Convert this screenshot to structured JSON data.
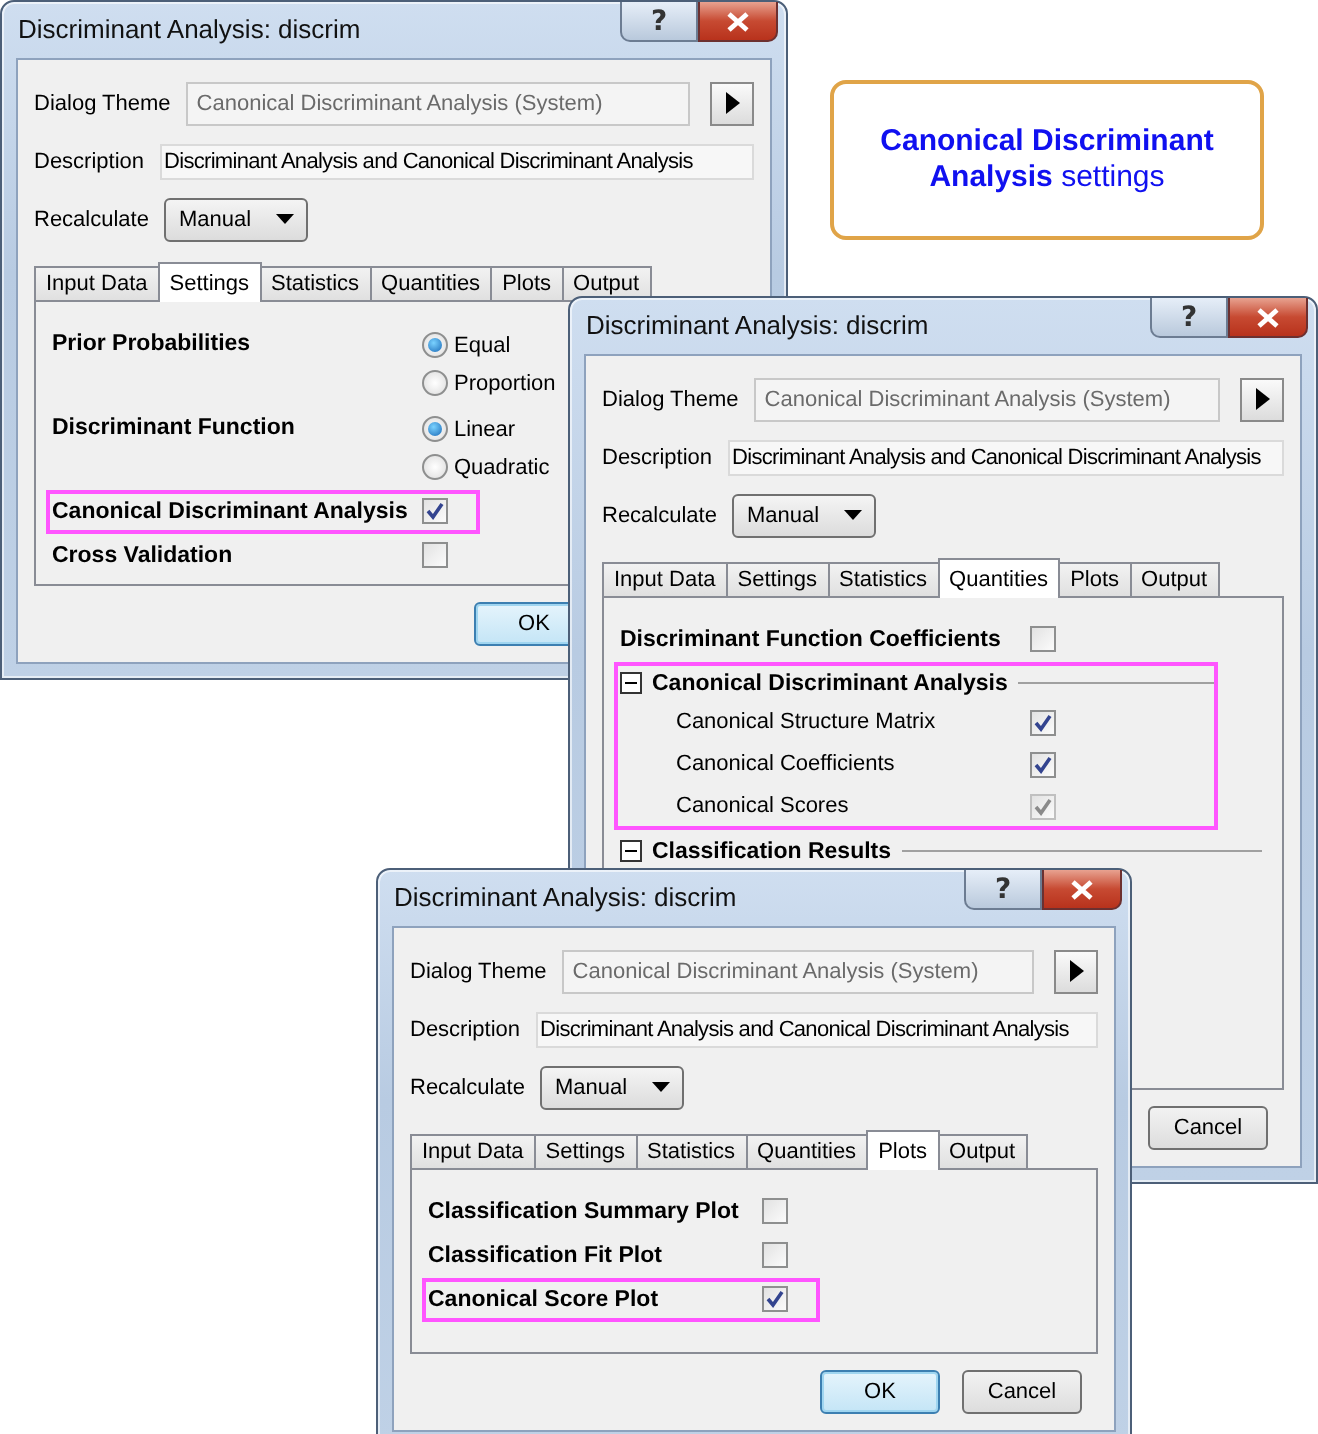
{
  "callout": {
    "text": "**Canonical Discriminant Analysis** settings"
  },
  "windows": [
    {
      "title": "Discriminant Analysis: discrim",
      "help_button": "?",
      "dialog_theme": {
        "label": "Dialog Theme",
        "value": "Canonical Discriminant Analysis (System)",
        "disabled": true
      },
      "description": {
        "label": "Description",
        "value": "Discriminant Analysis and Canonical Discriminant Analysis"
      },
      "recalculate": {
        "label": "Recalculate",
        "value": "Manual"
      },
      "tabs": [
        {
          "label": "Input Data",
          "selected": false
        },
        {
          "label": "Settings",
          "selected": true
        },
        {
          "label": "Statistics",
          "selected": false
        },
        {
          "label": "Quantities",
          "selected": false
        },
        {
          "label": "Plots",
          "selected": false
        },
        {
          "label": "Output",
          "selected": false
        }
      ],
      "options": [
        {
          "kind": "radio_group",
          "label": "Prior Probabilities",
          "choices": [
            {
              "label": "Equal",
              "selected": true
            },
            {
              "label": "Proportion",
              "selected": false
            }
          ]
        },
        {
          "kind": "radio_group",
          "label": "Discriminant Function",
          "choices": [
            {
              "label": "Linear",
              "selected": true
            },
            {
              "label": "Quadratic",
              "selected": false
            }
          ]
        },
        {
          "kind": "checkbox",
          "label": "Canonical Discriminant Analysis",
          "checked": true,
          "highlighted": true
        },
        {
          "kind": "checkbox",
          "label": "Cross Validation",
          "checked": false,
          "highlighted": false
        }
      ],
      "buttons": [
        {
          "label": "OK",
          "default": true
        }
      ]
    },
    {
      "title": "Discriminant Analysis: discrim",
      "help_button": "?",
      "dialog_theme": {
        "label": "Dialog Theme",
        "value": "Canonical Discriminant Analysis (System)",
        "disabled": true
      },
      "description": {
        "label": "Description",
        "value": "Discriminant Analysis and Canonical Discriminant Analysis"
      },
      "recalculate": {
        "label": "Recalculate",
        "value": "Manual"
      },
      "tabs": [
        {
          "label": "Input Data",
          "selected": false
        },
        {
          "label": "Settings",
          "selected": false
        },
        {
          "label": "Statistics",
          "selected": false
        },
        {
          "label": "Quantities",
          "selected": true
        },
        {
          "label": "Plots",
          "selected": false
        },
        {
          "label": "Output",
          "selected": false
        }
      ],
      "options": [
        {
          "kind": "checkbox",
          "label": "Discriminant Function Coefficients",
          "checked": false,
          "highlighted": false
        },
        {
          "kind": "group",
          "label": "Canonical Discriminant Analysis",
          "expanded": true,
          "highlighted": true,
          "children": [
            {
              "label": "Canonical Structure Matrix",
              "checked": true,
              "disabled": false
            },
            {
              "label": "Canonical Coefficients",
              "checked": true,
              "disabled": false
            },
            {
              "label": "Canonical Scores",
              "checked": true,
              "disabled": true
            }
          ]
        },
        {
          "kind": "group",
          "label": "Classification Results",
          "expanded": true,
          "highlighted": false
        }
      ],
      "buttons": [
        {
          "label": "Cancel",
          "default": false
        }
      ]
    },
    {
      "title": "Discriminant Analysis: discrim",
      "help_button": "?",
      "dialog_theme": {
        "label": "Dialog Theme",
        "value": "Canonical Discriminant Analysis (System)",
        "disabled": true
      },
      "description": {
        "label": "Description",
        "value": "Discriminant Analysis and Canonical Discriminant Analysis"
      },
      "recalculate": {
        "label": "Recalculate",
        "value": "Manual"
      },
      "tabs": [
        {
          "label": "Input Data",
          "selected": false
        },
        {
          "label": "Settings",
          "selected": false
        },
        {
          "label": "Statistics",
          "selected": false
        },
        {
          "label": "Quantities",
          "selected": false
        },
        {
          "label": "Plots",
          "selected": true
        },
        {
          "label": "Output",
          "selected": false
        }
      ],
      "options": [
        {
          "kind": "checkbox",
          "label": "Classification Summary Plot",
          "checked": false,
          "highlighted": false
        },
        {
          "kind": "checkbox",
          "label": "Classification Fit Plot",
          "checked": false,
          "highlighted": false
        },
        {
          "kind": "checkbox",
          "label": "Canonical Score Plot",
          "checked": true,
          "highlighted": true
        }
      ],
      "buttons": [
        {
          "label": "OK",
          "default": true
        },
        {
          "label": "Cancel",
          "default": false
        }
      ]
    }
  ]
}
